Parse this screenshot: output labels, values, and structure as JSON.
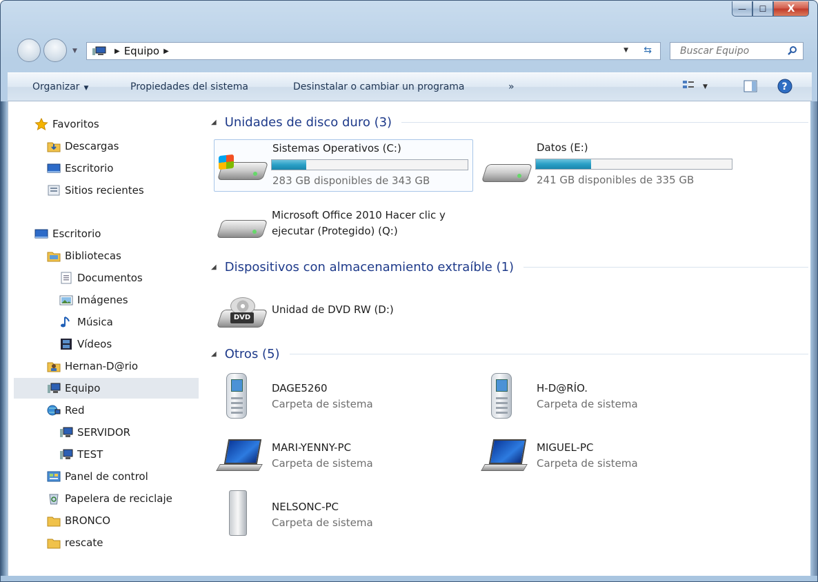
{
  "window": {
    "caption": {
      "minimize": "—",
      "maximize": "☐",
      "close": "X"
    }
  },
  "address": {
    "path": "Equipo",
    "search_placeholder": "Buscar Equipo"
  },
  "toolbar": {
    "organize": "Organizar",
    "system_properties": "Propiedades del sistema",
    "uninstall": "Desinstalar o cambiar un programa",
    "more": "»"
  },
  "sidebar": {
    "favorites": [
      {
        "label": "Favoritos",
        "icon": "star-icon"
      },
      {
        "label": "Descargas",
        "icon": "downloads-folder-icon"
      },
      {
        "label": "Escritorio",
        "icon": "desktop-icon"
      },
      {
        "label": "Sitios recientes",
        "icon": "recent-places-icon"
      }
    ],
    "tree": [
      {
        "label": "Escritorio",
        "icon": "desktop-icon"
      },
      {
        "label": "Bibliotecas",
        "icon": "libraries-icon"
      },
      {
        "label": "Documentos",
        "icon": "documents-icon"
      },
      {
        "label": "Imágenes",
        "icon": "pictures-icon"
      },
      {
        "label": "Música",
        "icon": "music-icon"
      },
      {
        "label": "Vídeos",
        "icon": "videos-icon"
      },
      {
        "label": "Hernan-D@rio",
        "icon": "user-folder-icon"
      },
      {
        "label": "Equipo",
        "icon": "computer-icon"
      },
      {
        "label": "Red",
        "icon": "network-icon"
      },
      {
        "label": "SERVIDOR",
        "icon": "computer-icon"
      },
      {
        "label": "TEST",
        "icon": "computer-icon"
      },
      {
        "label": "Panel de control",
        "icon": "control-panel-icon"
      },
      {
        "label": "Papelera de reciclaje",
        "icon": "recycle-bin-icon"
      },
      {
        "label": "BRONCO",
        "icon": "folder-icon"
      },
      {
        "label": "rescate",
        "icon": "folder-icon"
      }
    ]
  },
  "groups": {
    "hard_drives": "Unidades de disco duro (3)",
    "removable": "Dispositivos con almacenamiento extraíble (1)",
    "others": "Otros (5)"
  },
  "drives": [
    {
      "name": "Sistemas Operativos (C:)",
      "free": "283 GB disponibles de 343 GB",
      "used_fraction": 0.175
    },
    {
      "name": "Datos (E:)",
      "free": "241 GB disponibles de 335 GB",
      "used_fraction": 0.28
    },
    {
      "name_line1": "Microsoft Office 2010 Hacer clic y",
      "name_line2": "ejecutar (Protegido) (Q:)"
    }
  ],
  "removable": [
    {
      "name": "Unidad de DVD RW (D:)",
      "badge": "DVD"
    }
  ],
  "others": [
    {
      "name": "DAGE5260",
      "type": "Carpeta de sistema"
    },
    {
      "name": "H-D@RÍO.",
      "type": "Carpeta de sistema"
    },
    {
      "name": "MARI-YENNY-PC",
      "type": "Carpeta de sistema"
    },
    {
      "name": "MIGUEL-PC",
      "type": "Carpeta de sistema"
    },
    {
      "name": "NELSONC-PC",
      "type": "Carpeta de sistema"
    }
  ],
  "colors": {
    "group_header": "#1e3a8a",
    "usage_bar": "#2aa0c6",
    "selection": "#e3e8ee"
  }
}
